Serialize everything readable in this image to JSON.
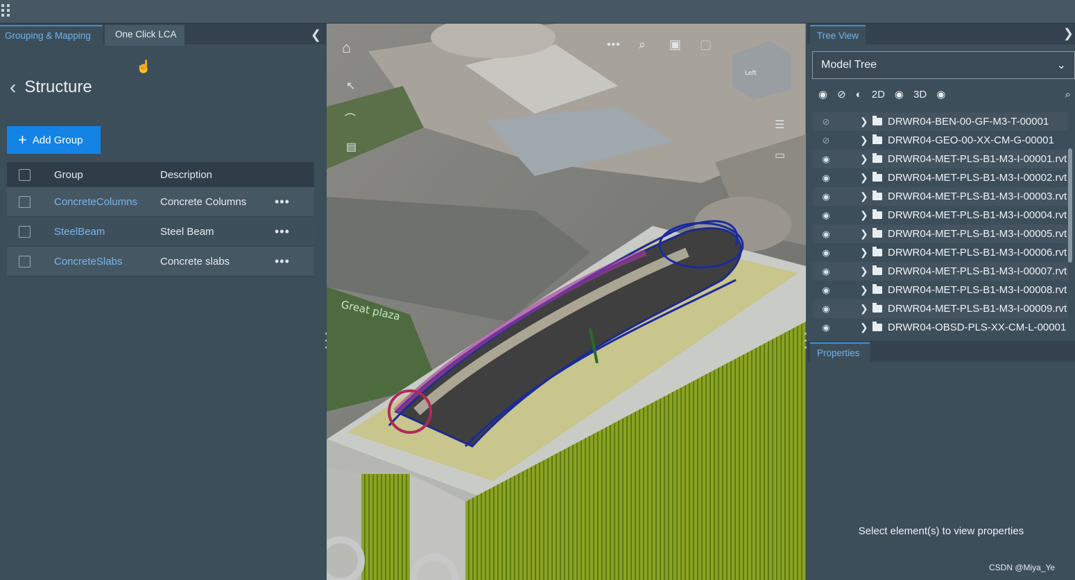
{
  "left_panel": {
    "tabs": [
      "Grouping & Mapping",
      "One Click LCA"
    ],
    "back_title": "Structure",
    "add_group_label": "Add Group",
    "table": {
      "headers": [
        "Group",
        "Description"
      ],
      "rows": [
        {
          "group": "ConcreteColumns",
          "description": "Concrete Columns"
        },
        {
          "group": "SteelBeam",
          "description": "Steel Beam"
        },
        {
          "group": "ConcreteSlabs",
          "description": "Concrete slabs"
        }
      ]
    },
    "row_menu": "•••"
  },
  "viewer": {
    "map_label": "Great plaza",
    "cube_label": "Left",
    "toolbar_dots": "•••"
  },
  "right_panel": {
    "tab": "Tree View",
    "select_value": "Model Tree",
    "toolbar": {
      "label_2d": "2D",
      "label_3d": "3D"
    },
    "tree_items": [
      {
        "name": "DRWR04-BEN-00-GF-M3-T-00001",
        "visible": false
      },
      {
        "name": "DRWR04-GEO-00-XX-CM-G-00001",
        "visible": false
      },
      {
        "name": "DRWR04-MET-PLS-B1-M3-I-00001.rvt",
        "visible": true
      },
      {
        "name": "DRWR04-MET-PLS-B1-M3-I-00002.rvt",
        "visible": true
      },
      {
        "name": "DRWR04-MET-PLS-B1-M3-I-00003.rvt",
        "visible": true
      },
      {
        "name": "DRWR04-MET-PLS-B1-M3-I-00004.rvt",
        "visible": true
      },
      {
        "name": "DRWR04-MET-PLS-B1-M3-I-00005.rvt",
        "visible": true
      },
      {
        "name": "DRWR04-MET-PLS-B1-M3-I-00006.rvt",
        "visible": true
      },
      {
        "name": "DRWR04-MET-PLS-B1-M3-I-00007.rvt",
        "visible": true
      },
      {
        "name": "DRWR04-MET-PLS-B1-M3-I-00008.rvt",
        "visible": true
      },
      {
        "name": "DRWR04-MET-PLS-B1-M3-I-00009.rvt",
        "visible": true
      },
      {
        "name": "DRWR04-OBSD-PLS-XX-CM-L-00001",
        "visible": true
      }
    ],
    "properties_tab": "Properties",
    "properties_message": "Select element(s) to view properties"
  },
  "watermark": "CSDN @Miya_Ye"
}
